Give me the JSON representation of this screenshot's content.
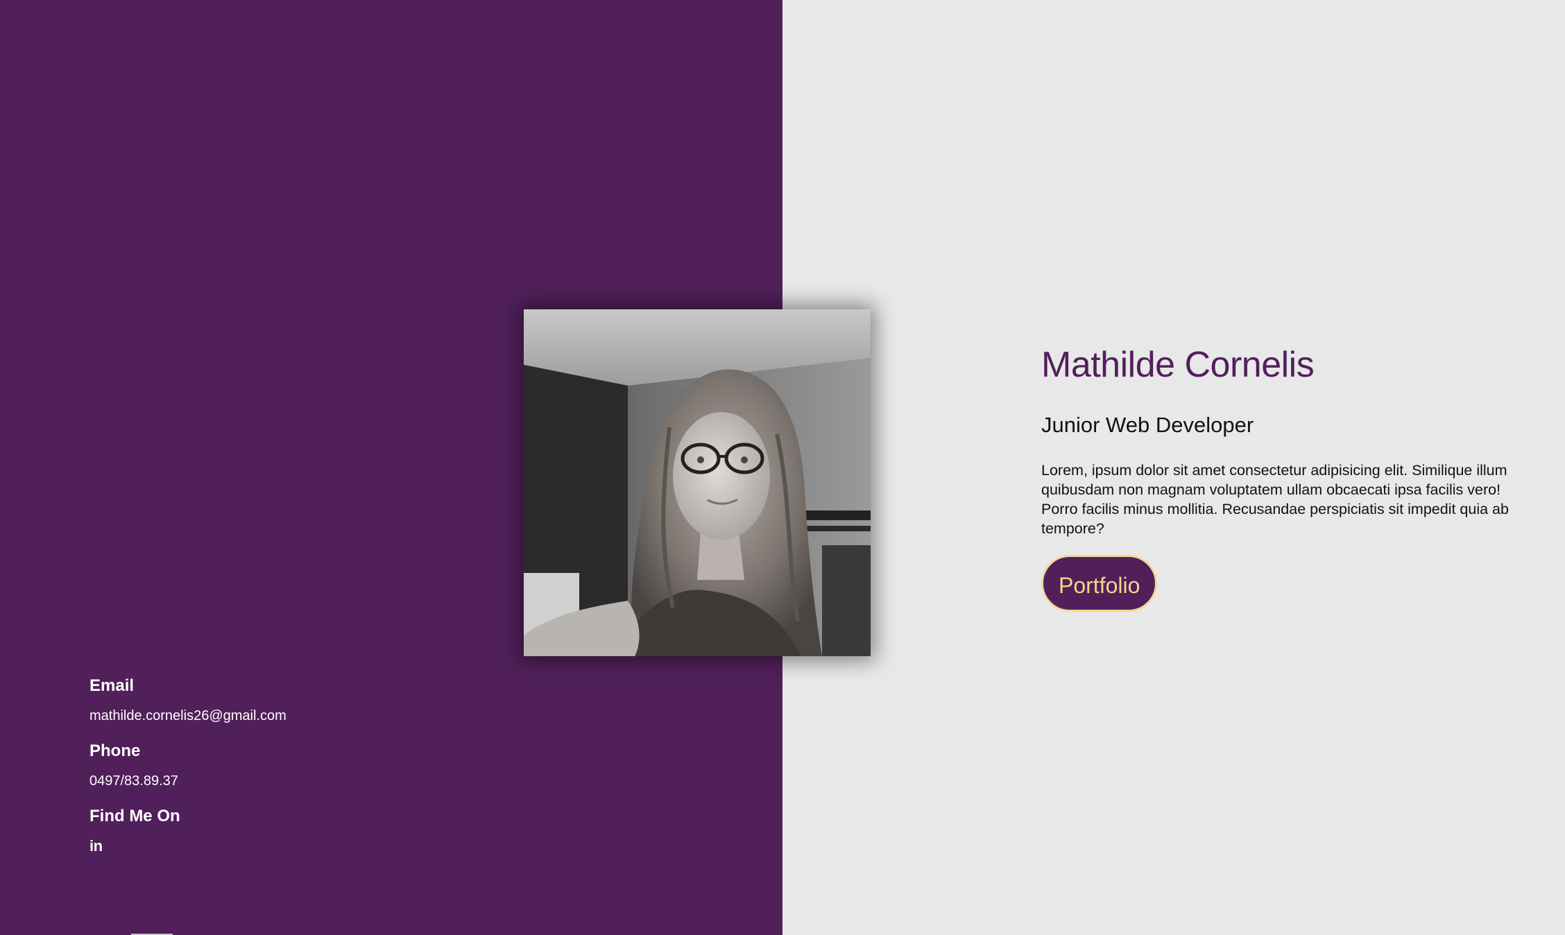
{
  "colors": {
    "accent_purple": "#51205a",
    "background_light": "#e8e8e8",
    "button_text": "#f5d68a"
  },
  "contact": {
    "email_heading": "Email",
    "email_value": "mathilde.cornelis26@gmail.com",
    "phone_heading": "Phone",
    "phone_value": "0497/83.89.37",
    "social_heading": "Find Me On",
    "social_icon": "linkedin-icon",
    "social_icon_text": "in"
  },
  "profile": {
    "photo_alt": "portrait-photo"
  },
  "intro": {
    "name": "Mathilde Cornelis",
    "role": "Junior Web Developer",
    "bio": "Lorem, ipsum dolor sit amet consectetur adipisicing elit. Similique illum quibusdam non magnam voluptatem ullam obcaecati ipsa facilis vero! Porro facilis minus mollitia. Recusandae perspiciatis sit impedit quia ab tempore?",
    "button_label": "Portfolio"
  }
}
